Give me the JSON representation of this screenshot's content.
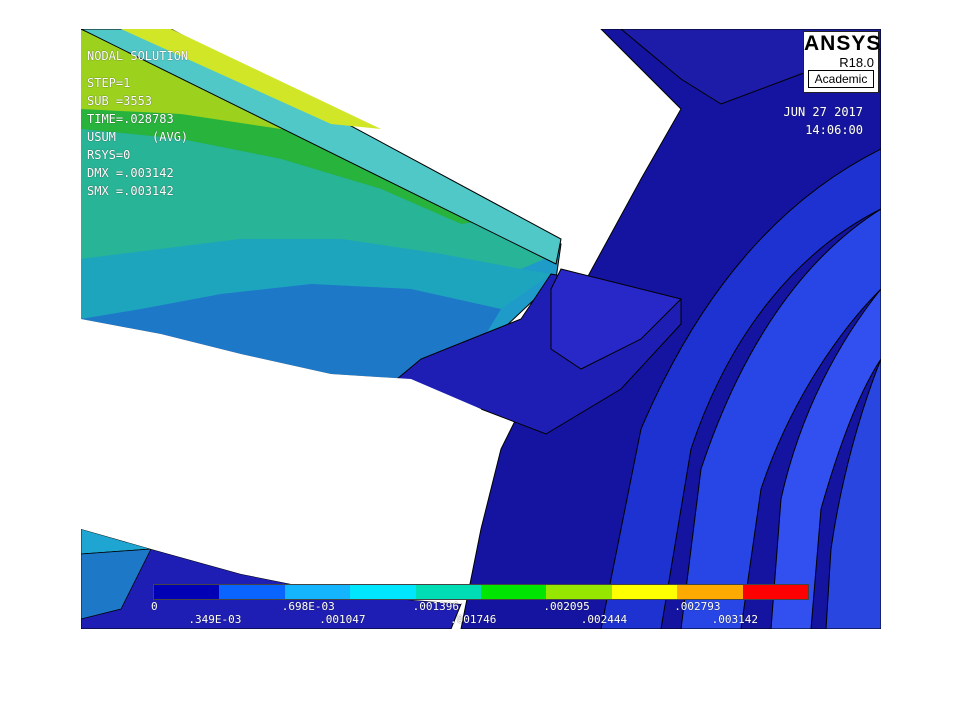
{
  "window": {
    "title_lines": [
      "NODAL SOLUTION",
      "STEP=1",
      "SUB =3553",
      "TIME=.028783",
      "USUM     (AVG)",
      "RSYS=0",
      "DMX =.003142",
      "SMX =.003142"
    ],
    "date": "JUN 27 2017",
    "time": "14:06:00"
  },
  "logo": {
    "brand": "ANSYS",
    "version": "R18.0",
    "edition": "Academic"
  },
  "legend": {
    "colors": [
      "#0000b4",
      "#0a64ff",
      "#14b4ff",
      "#00e6ff",
      "#00dcb4",
      "#00e600",
      "#96e600",
      "#ffff00",
      "#ffaa00",
      "#ff0000"
    ],
    "top_labels": [
      "0",
      ".698E-03",
      ".001396",
      ".002095",
      ".002793"
    ],
    "bottom_labels": [
      ".349E-03",
      ".001047",
      ".001746",
      ".002444",
      ".003142"
    ]
  }
}
